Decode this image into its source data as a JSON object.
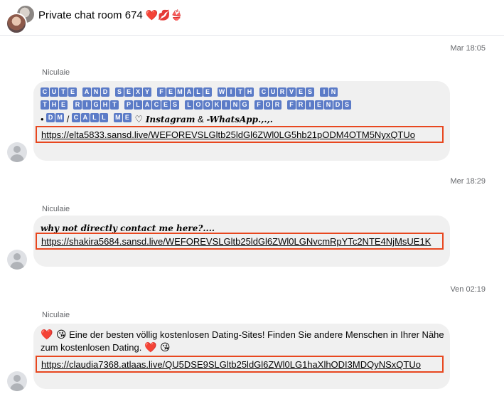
{
  "header": {
    "title": "Private chat room 674",
    "title_emoji": "❤️💋👙"
  },
  "messages": [
    {
      "timestamp": "Mar 18:05",
      "sender": "Niculaie",
      "boxed_line_1": "CUTE AND SEXY FEMALE WITH CURVES IN",
      "boxed_line_2": "THE RIGHT PLACES LOOKING FOR FRIENDS",
      "line_2_parts": [
        "•",
        "DM",
        "/",
        "CALL ME",
        "♡",
        "Instagram",
        "&",
        "-WhatsApp.,.,."
      ],
      "link": "https://elta5833.sansd.live/WEFOREVSLGltb25ldGl6ZWl0LG5hb21pODM4OTM5NyxQTUo"
    },
    {
      "timestamp": "Mer 18:29",
      "sender": "Niculaie",
      "text": "why not directly contact me here?....",
      "link": "https://shakira5684.sansd.live/WEFOREVSLGltb25ldGl6ZWl0LGNvcmRpYTc2NTE4NjMsUE1K"
    },
    {
      "timestamp": "Ven 02:19",
      "sender": "Niculaie",
      "emoji_prefix": "❤️ 😘",
      "text": "Eine der besten völlig kostenlosen Dating-Sites! Finden Sie andere Menschen in Ihrer Nähe zum kostenlosen Dating.",
      "emoji_suffix": "❤️ 😘",
      "link": "https://claudia7368.atlaas.live/QU5DSE9SLGltb25ldGl6ZWl0LG1haXlhODI3MDQyNSxQTUo"
    }
  ],
  "colors": {
    "bubble": "#f0f0f0",
    "highlight_border": "#e8471f",
    "boxed_letter_bg": "#5b7bc7"
  }
}
